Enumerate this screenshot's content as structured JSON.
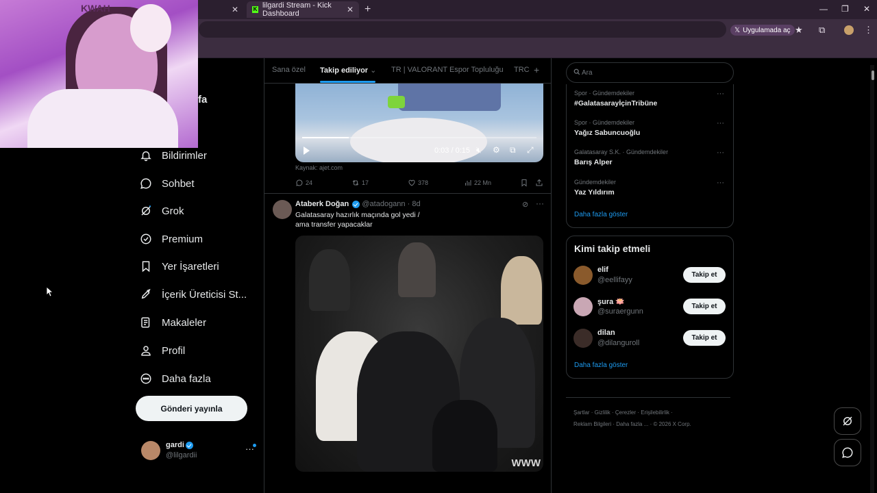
{
  "browser": {
    "tabs": [
      {
        "label": ""
      },
      {
        "label": "lilgardi Stream - Kick Dashboard"
      }
    ],
    "open_in_app_label": "Uygulamada aç"
  },
  "webcam": {
    "overlay_text": "KWAH"
  },
  "nav": {
    "partial_label": "fa",
    "items": [
      {
        "label": "Bildirimler",
        "icon": "bell-icon"
      },
      {
        "label": "Sohbet",
        "icon": "chat-icon"
      },
      {
        "label": "Grok",
        "icon": "grok-icon"
      },
      {
        "label": "Premium",
        "icon": "premium-check-icon"
      },
      {
        "label": "Yer İşaretleri",
        "icon": "bookmark-icon"
      },
      {
        "label": "İçerik Üreticisi St...",
        "icon": "rocket-icon"
      },
      {
        "label": "Makaleler",
        "icon": "article-icon"
      },
      {
        "label": "Profil",
        "icon": "person-icon"
      },
      {
        "label": "Daha fazla",
        "icon": "more-circle-icon"
      }
    ],
    "post_button": "Gönderi yayınla",
    "account": {
      "name": "gardi",
      "handle": "@lilgardii"
    }
  },
  "feed": {
    "tabs": [
      {
        "label": "Sana özel"
      },
      {
        "label": "Takip ediliyor"
      },
      {
        "label": "TR | VALORANT Espor Topluluğu"
      },
      {
        "label": "TRC"
      }
    ],
    "tweet1": {
      "video_time": "0:03 / 0:15",
      "video_progress": 0.2,
      "source": "Kaynak: ajet.com",
      "replies": "24",
      "reposts": "17",
      "likes": "378",
      "views": "22 Mn"
    },
    "tweet2": {
      "author": "Ataberk Doğan",
      "handle": "@atadogann",
      "time": "8d",
      "text_line1": "Galatasaray hazırlık maçında gol yedi /",
      "text_line2": "ama transfer yapacaklar",
      "video_watermark": "WWW"
    }
  },
  "sidebar": {
    "search_placeholder": "Ara",
    "trends": [
      {
        "category": "Spor · Gündemdekiler",
        "name": "#GalatasarayİçinTribüne"
      },
      {
        "category": "Spor · Gündemdekiler",
        "name": "Yağız Sabuncuoğlu"
      },
      {
        "category": "Galatasaray S.K. · Gündemdekiler",
        "name": "Barış Alper"
      },
      {
        "category": "Gündemdekiler",
        "name": "Yaz Yıldırım"
      }
    ],
    "trends_show_more": "Daha fazla göster",
    "who_to_follow_title": "Kimi takip etmeli",
    "suggestions": [
      {
        "name": "elif",
        "handle": "@eellifayy",
        "button": "Takip et"
      },
      {
        "name": "şura 🪷",
        "handle": "@suraergunn",
        "button": "Takip et"
      },
      {
        "name": "dilan",
        "handle": "@dilanguroll",
        "button": "Takip et"
      }
    ],
    "wtf_show_more": "Daha fazla göster",
    "footer_line1": "Şartlar · Gizlilik · Çerezler · Erişilebilirlik ·",
    "footer_line2": "Reklam Bilgileri · Daha fazla ... · © 2026 X Corp."
  }
}
